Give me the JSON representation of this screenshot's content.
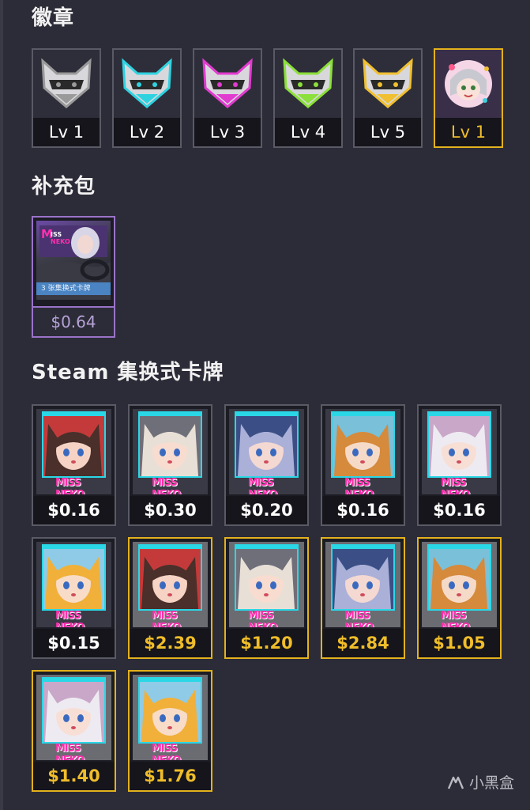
{
  "sections": {
    "badges_title": "徽章",
    "booster_title": "补充包",
    "cards_title": "Steam 集换式卡牌"
  },
  "badges": [
    {
      "level": "Lv 1",
      "icon": "fox-badge-gray-icon",
      "color": "#9a9a9a"
    },
    {
      "level": "Lv 2",
      "icon": "fox-badge-cyan-icon",
      "color": "#2fd3e0"
    },
    {
      "level": "Lv 3",
      "icon": "fox-badge-magenta-icon",
      "color": "#e23bd0"
    },
    {
      "level": "Lv 4",
      "icon": "fox-badge-green-icon",
      "color": "#8ce03a"
    },
    {
      "level": "Lv 5",
      "icon": "fox-badge-gold-icon",
      "color": "#f0c030"
    },
    {
      "level": "Lv 1",
      "icon": "foil-badge-chibi-icon",
      "color": "#f4d6e6",
      "foil": true
    }
  ],
  "booster": {
    "label": "3 张集换式卡牌",
    "logo": "MISS NEKO",
    "price": "$0.64"
  },
  "cards": [
    {
      "price": "$0.16",
      "foil": false,
      "hair": "#4a2f2a",
      "skin": "#f6d3c4",
      "bg": "#c43a3a"
    },
    {
      "price": "$0.30",
      "foil": false,
      "hair": "#e8e0d6",
      "skin": "#f7dccf",
      "bg": "#6f6f7a"
    },
    {
      "price": "$0.20",
      "foil": false,
      "hair": "#aab0d8",
      "skin": "#f4d8d2",
      "bg": "#3b4f86"
    },
    {
      "price": "$0.16",
      "foil": false,
      "hair": "#d58a3c",
      "skin": "#f6dac8",
      "bg": "#7ac0d8"
    },
    {
      "price": "$0.16",
      "foil": false,
      "hair": "#eeeaf2",
      "skin": "#f7dfd6",
      "bg": "#c9a7c9"
    },
    {
      "price": "$0.15",
      "foil": false,
      "hair": "#f0b03a",
      "skin": "#f8dcc8",
      "bg": "#8fcbe6"
    },
    {
      "price": "$2.39",
      "foil": true,
      "hair": "#4a2f2a",
      "skin": "#f6d3c4",
      "bg": "#c43a3a"
    },
    {
      "price": "$1.20",
      "foil": true,
      "hair": "#e8e0d6",
      "skin": "#f7dccf",
      "bg": "#6f6f7a"
    },
    {
      "price": "$2.84",
      "foil": true,
      "hair": "#aab0d8",
      "skin": "#f4d8d2",
      "bg": "#3b4f86"
    },
    {
      "price": "$1.05",
      "foil": true,
      "hair": "#d58a3c",
      "skin": "#f6dac8",
      "bg": "#7ac0d8"
    },
    {
      "price": "$1.40",
      "foil": true,
      "hair": "#eeeaf2",
      "skin": "#f7dfd6",
      "bg": "#c9a7c9"
    },
    {
      "price": "$1.76",
      "foil": true,
      "hair": "#f0b03a",
      "skin": "#f8dcc8",
      "bg": "#8fcbe6"
    }
  ],
  "card_logo": "MISS NEKO",
  "watermark": "小黑盒",
  "colors": {
    "foil_border": "#e3b21c",
    "foil_price": "#f0bd2a",
    "booster_border": "#9a73c9"
  }
}
